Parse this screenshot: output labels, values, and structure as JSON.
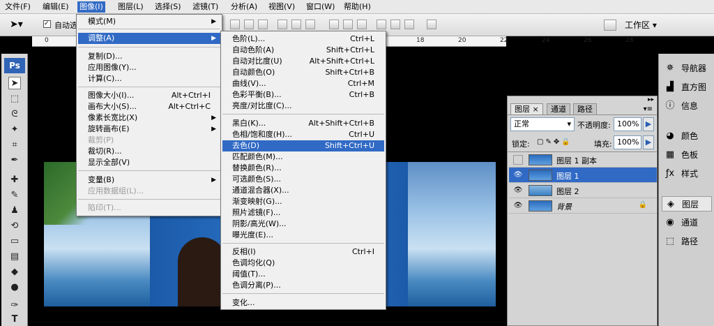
{
  "menubar": [
    "文件(F)",
    "编辑(E)",
    "图像(I)",
    "图层(L)",
    "选择(S)",
    "滤镜(T)",
    "分析(A)",
    "视图(V)",
    "窗口(W)",
    "帮助(H)"
  ],
  "options": {
    "auto_select": "自动选",
    "workspace": "工作区"
  },
  "ruler": [
    "0",
    "18",
    "20",
    "22",
    "24",
    "26",
    "28"
  ],
  "image_menu": [
    {
      "label": "模式(M)",
      "sub": true
    },
    {
      "label": "调整(A)",
      "sub": true,
      "hl": true
    },
    {
      "label": "复制(D)..."
    },
    {
      "label": "应用图像(Y)..."
    },
    {
      "label": "计算(C)..."
    },
    {
      "label": "图像大小(I)...",
      "sc": "Alt+Ctrl+I"
    },
    {
      "label": "画布大小(S)...",
      "sc": "Alt+Ctrl+C"
    },
    {
      "label": "像素长宽比(X)",
      "sub": true
    },
    {
      "label": "旋转画布(E)",
      "sub": true
    },
    {
      "label": "裁剪(P)",
      "dis": true
    },
    {
      "label": "裁切(R)..."
    },
    {
      "label": "显示全部(V)"
    },
    {
      "label": "变量(B)",
      "sub": true
    },
    {
      "label": "应用数据组(L)...",
      "dis": true
    },
    {
      "label": "陷印(T)...",
      "dis": true
    }
  ],
  "adjust_menu": [
    {
      "label": "色阶(L)...",
      "sc": "Ctrl+L"
    },
    {
      "label": "自动色阶(A)",
      "sc": "Shift+Ctrl+L"
    },
    {
      "label": "自动对比度(U)",
      "sc": "Alt+Shift+Ctrl+L"
    },
    {
      "label": "自动颜色(O)",
      "sc": "Shift+Ctrl+B"
    },
    {
      "label": "曲线(V)...",
      "sc": "Ctrl+M"
    },
    {
      "label": "色彩平衡(B)...",
      "sc": "Ctrl+B"
    },
    {
      "label": "亮度/对比度(C)..."
    },
    {
      "label": "黑白(K)...",
      "sc": "Alt+Shift+Ctrl+B"
    },
    {
      "label": "色相/饱和度(H)...",
      "sc": "Ctrl+U"
    },
    {
      "label": "去色(D)",
      "sc": "Shift+Ctrl+U",
      "hl": true
    },
    {
      "label": "匹配颜色(M)..."
    },
    {
      "label": "替换颜色(R)..."
    },
    {
      "label": "可选颜色(S)..."
    },
    {
      "label": "通道混合器(X)..."
    },
    {
      "label": "渐变映射(G)..."
    },
    {
      "label": "照片滤镜(F)..."
    },
    {
      "label": "阴影/高光(W)..."
    },
    {
      "label": "曝光度(E)..."
    },
    {
      "label": "反相(I)",
      "sc": "Ctrl+I"
    },
    {
      "label": "色调均化(Q)"
    },
    {
      "label": "阈值(T)..."
    },
    {
      "label": "色调分离(P)..."
    },
    {
      "label": "变化..."
    }
  ],
  "layers_panel": {
    "tabs": [
      "图层",
      "通道",
      "路径"
    ],
    "blend": "正常",
    "opacity_label": "不透明度:",
    "opacity": "100%",
    "lock_label": "锁定:",
    "fill_label": "填充:",
    "fill": "100%",
    "layers": [
      "图层 1 副本",
      "图层 1",
      "图层 2",
      "背景"
    ]
  },
  "dock": [
    "导航器",
    "直方图",
    "信息",
    "颜色",
    "色板",
    "样式",
    "图层",
    "通道",
    "路径"
  ],
  "colors": {
    "highlight": "#316ac5"
  }
}
